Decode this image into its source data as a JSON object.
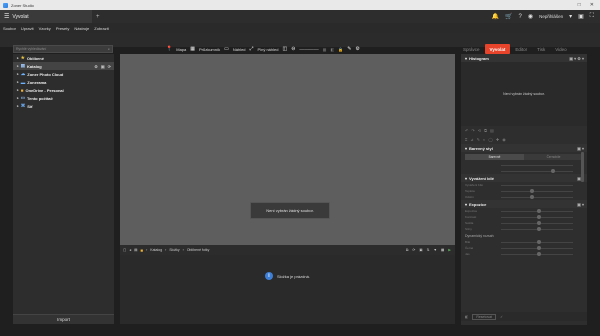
{
  "titlebar": {
    "title": "Zoner Studio",
    "buttons": [
      "□",
      "✕"
    ]
  },
  "tab": {
    "label": "Vyvolat"
  },
  "topright": {
    "user": "Nepřihlášen"
  },
  "menu": [
    "Soubor",
    "Upravit",
    "Vzorky",
    "Presety",
    "Nástroje",
    "Zobrazit"
  ],
  "search": {
    "placeholder": "Rychlé vyhledávání"
  },
  "toolbar": {
    "map": "Mapa",
    "explorer": "Průzkumník",
    "preview": "Náhled",
    "full": "Plný náhled"
  },
  "modes": [
    "Správce",
    "Vyvolat",
    "Editor",
    "Tisk",
    "Video"
  ],
  "active_mode_index": 1,
  "sidebar": {
    "items": [
      {
        "label": "Oblíbené",
        "icon": "star-icon"
      },
      {
        "label": "Katalog",
        "icon": "catalog-icon"
      },
      {
        "label": "Zoner Photo Cloud",
        "icon": "cloud-icon"
      },
      {
        "label": "Zonerama",
        "icon": "zonerama-icon"
      },
      {
        "label": "OneDrive - Personal",
        "icon": "onedrive-icon"
      },
      {
        "label": "Tento počítač",
        "icon": "computer-icon"
      },
      {
        "label": "Síť",
        "icon": "network-icon"
      }
    ],
    "import_label": "Import"
  },
  "viewer": {
    "message": "Není vybrán žádný soubor."
  },
  "filmbar": {
    "crumbs": [
      "Katalog",
      "Složky",
      "Oblíbené fotky"
    ]
  },
  "filmstrip": {
    "empty_text": "Složka je prázdná."
  },
  "rpanel": {
    "histogram_title": "Histogram",
    "histogram_empty": "Není vybrán žádný soubor.",
    "bw_title": "Barevný styl",
    "bw_modes": [
      "Barevně",
      "Černobíle"
    ],
    "wb_title": "Vyvážení bílé",
    "wb_rows": [
      "Vyvážení bílé",
      "Teplota",
      "Odstín"
    ],
    "exp_title": "Expozice",
    "exp_rows": [
      "Expozice",
      "Kontrast",
      "Světla",
      "Stíny"
    ],
    "dyn_title": "Dynamický rozsah",
    "dyn_rows": [
      "Bílé",
      "Černé",
      "Jas"
    ],
    "bottom": [
      "Resetovat"
    ]
  }
}
